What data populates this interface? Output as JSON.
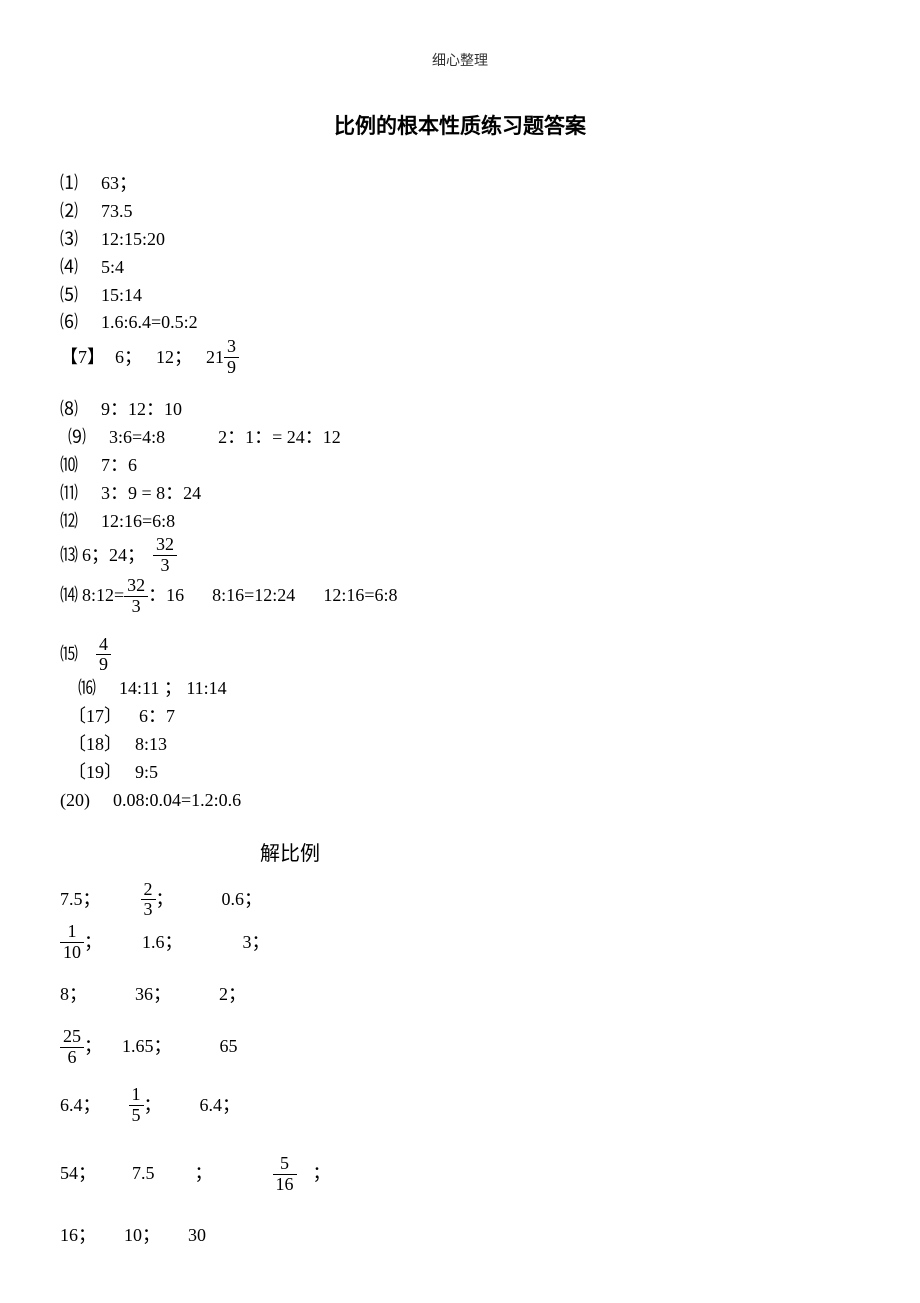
{
  "header": "细心整理",
  "title": "比例的根本性质练习题答案",
  "answers": {
    "a1": {
      "label": "⑴",
      "text": "63；"
    },
    "a2": {
      "label": "⑵",
      "text": "73.5"
    },
    "a3": {
      "label": "⑶",
      "text": "12:15:20"
    },
    "a4": {
      "label": "⑷",
      "text": "5:4"
    },
    "a5": {
      "label": "⑸",
      "text": "15:14"
    },
    "a6": {
      "label": "⑹",
      "text": "1.6:6.4=0.5:2"
    },
    "a7": {
      "label": "【7】",
      "v1": "6；",
      "v2": "12；",
      "v3": "21",
      "frac": {
        "num": "3",
        "den": "9"
      }
    },
    "a8": {
      "label": "⑻",
      "text": "9：12：10"
    },
    "a9": {
      "label": "⑼",
      "p1": "3:6=4:8",
      "p2": "2：1：= 24：12"
    },
    "a10": {
      "label": "⑽",
      "text": "7：6"
    },
    "a11": {
      "label": "⑾",
      "text": "3：9 = 8：24"
    },
    "a12": {
      "label": "⑿",
      "text": "12:16=6:8"
    },
    "a13": {
      "label": "⒀",
      "v1": "6；24；",
      "frac": {
        "num": "32",
        "den": "3"
      }
    },
    "a14": {
      "label": "⒁",
      "v1": "8:12=",
      "frac": {
        "num": "32",
        "den": "3"
      },
      "v2": "：16",
      "v3": "8:16=12:24",
      "v4": "12:16=6:8"
    },
    "a15": {
      "label": "⒂",
      "frac": {
        "num": "4",
        "den": "9"
      }
    },
    "a16": {
      "label": "⒃",
      "text": "14:11   ；    11:14"
    },
    "a17": {
      "label": "〔17〕",
      "text": "6：7"
    },
    "a18": {
      "label": "〔18〕",
      "text": "8:13"
    },
    "a19": {
      "label": "〔19〕",
      "text": "9:5"
    },
    "a20": {
      "label": "(20)",
      "text": "0.08:0.04=1.2:0.6"
    }
  },
  "section2_title": "解比例",
  "solve": {
    "r1": {
      "v1": "7.5；",
      "frac": {
        "num": "2",
        "den": "3"
      },
      "sep1": "；",
      "v3": "0.6；"
    },
    "r2": {
      "frac": {
        "num": "1",
        "den": "10"
      },
      "sep1": "；",
      "v2": "1.6；",
      "v3": "3；"
    },
    "r3": {
      "v1": "8；",
      "v2": "36；",
      "v3": "2；"
    },
    "r4": {
      "frac": {
        "num": "25",
        "den": "6"
      },
      "sep1": "；",
      "v2": "1.65；",
      "v3": "65"
    },
    "r5": {
      "v1": "6.4；",
      "frac": {
        "num": "1",
        "den": "5"
      },
      "sep1": "；",
      "v3": "6.4；"
    },
    "r6": {
      "v1": "54；",
      "v2": "7.5",
      "sep2": "；",
      "frac": {
        "num": "5",
        "den": "16"
      },
      "sep3": "；"
    },
    "r7": {
      "v1": "16；",
      "v2": "10；",
      "v3": "30"
    }
  }
}
